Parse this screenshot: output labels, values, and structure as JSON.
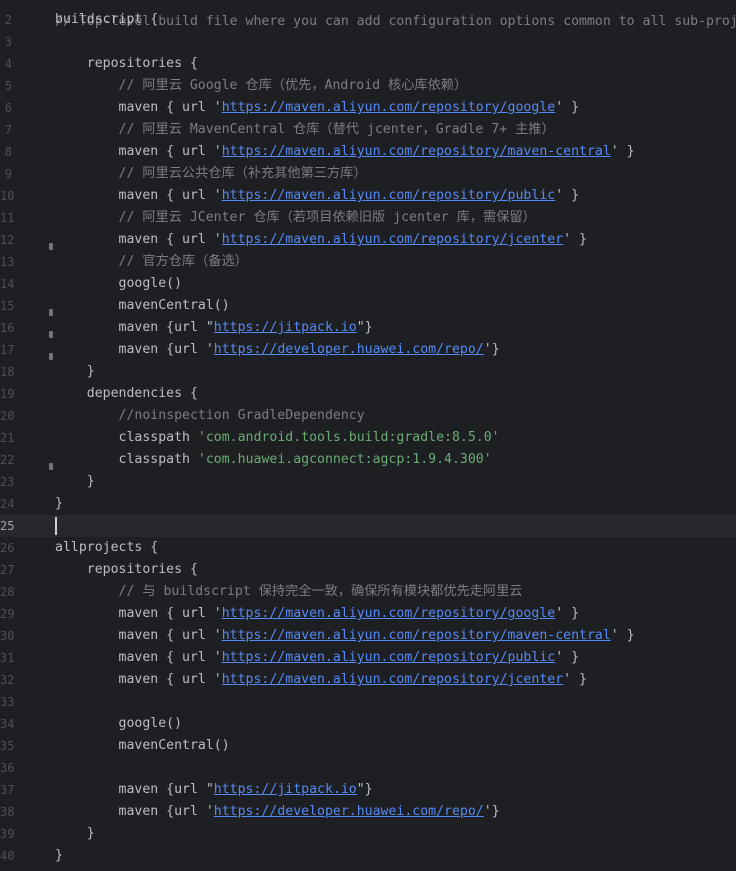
{
  "editor": {
    "top_comment": "// Top-level build file where you can add configuration options common to all sub-projects/modules.",
    "lines": [
      {
        "n": "2",
        "segs": [
          {
            "t": "buildscript {",
            "c": "kw"
          }
        ]
      },
      {
        "n": "3",
        "segs": []
      },
      {
        "n": "4",
        "segs": [
          {
            "t": "    repositories {",
            "c": "kw"
          }
        ]
      },
      {
        "n": "5",
        "segs": [
          {
            "t": "        // 阿里云 Google 仓库（优先，Android 核心库依赖）",
            "c": "cm"
          }
        ]
      },
      {
        "n": "6",
        "segs": [
          {
            "t": "        maven { url '",
            "c": "kw"
          },
          {
            "t": "https://maven.aliyun.com/repository/google",
            "c": "url"
          },
          {
            "t": "' }",
            "c": "kw"
          }
        ]
      },
      {
        "n": "7",
        "segs": [
          {
            "t": "        // 阿里云 MavenCentral 仓库（替代 jcenter，Gradle 7+ 主推）",
            "c": "cm"
          }
        ]
      },
      {
        "n": "8",
        "segs": [
          {
            "t": "        maven { url '",
            "c": "kw"
          },
          {
            "t": "https://maven.aliyun.com/repository/maven-central",
            "c": "url"
          },
          {
            "t": "' }",
            "c": "kw"
          }
        ]
      },
      {
        "n": "9",
        "segs": [
          {
            "t": "        // 阿里云公共仓库（补充其他第三方库）",
            "c": "cm"
          }
        ]
      },
      {
        "n": "10",
        "segs": [
          {
            "t": "        maven { url '",
            "c": "kw"
          },
          {
            "t": "https://maven.aliyun.com/repository/public",
            "c": "url"
          },
          {
            "t": "' }",
            "c": "kw"
          }
        ]
      },
      {
        "n": "11",
        "segs": [
          {
            "t": "        // 阿里云 JCenter 仓库（若项目依赖旧版 jcenter 库，需保留）",
            "c": "cm"
          }
        ]
      },
      {
        "n": "12",
        "segs": [
          {
            "t": "        maven { url '",
            "c": "kw"
          },
          {
            "t": "https://maven.aliyun.com/repository/jcenter",
            "c": "url"
          },
          {
            "t": "' }",
            "c": "kw"
          }
        ]
      },
      {
        "n": "13",
        "segs": [
          {
            "t": "        // 官方仓库（备选）",
            "c": "cm"
          }
        ]
      },
      {
        "n": "14",
        "segs": [
          {
            "t": "        google()",
            "c": "kw"
          }
        ]
      },
      {
        "n": "15",
        "segs": [
          {
            "t": "        mavenCentral()",
            "c": "kw"
          }
        ]
      },
      {
        "n": "16",
        "segs": [
          {
            "t": "        maven {url \"",
            "c": "kw"
          },
          {
            "t": "https://jitpack.io",
            "c": "url"
          },
          {
            "t": "\"}",
            "c": "kw"
          }
        ]
      },
      {
        "n": "17",
        "segs": [
          {
            "t": "        maven {url '",
            "c": "kw"
          },
          {
            "t": "https://developer.huawei.com/repo/",
            "c": "url"
          },
          {
            "t": "'}",
            "c": "kw"
          }
        ]
      },
      {
        "n": "18",
        "segs": [
          {
            "t": "    }",
            "c": "kw"
          }
        ]
      },
      {
        "n": "19",
        "segs": [
          {
            "t": "    dependencies {",
            "c": "kw"
          }
        ]
      },
      {
        "n": "20",
        "segs": [
          {
            "t": "        //noinspection GradleDependency",
            "c": "cm"
          }
        ]
      },
      {
        "n": "21",
        "segs": [
          {
            "t": "        classpath ",
            "c": "kw"
          },
          {
            "t": "'com.android.tools.build:gradle:8.5.0'",
            "c": "str"
          }
        ]
      },
      {
        "n": "22",
        "segs": [
          {
            "t": "        classpath ",
            "c": "kw"
          },
          {
            "t": "'com.huawei.agconnect:agcp:1.9.4.300'",
            "c": "str"
          }
        ]
      },
      {
        "n": "23",
        "segs": [
          {
            "t": "    }",
            "c": "kw"
          }
        ]
      },
      {
        "n": "24",
        "segs": [
          {
            "t": "}",
            "c": "kw"
          }
        ]
      },
      {
        "n": "25",
        "segs": [],
        "current": true
      },
      {
        "n": "26",
        "segs": [
          {
            "t": "allprojects {",
            "c": "kw"
          }
        ]
      },
      {
        "n": "27",
        "segs": [
          {
            "t": "    repositories {",
            "c": "kw"
          }
        ]
      },
      {
        "n": "28",
        "segs": [
          {
            "t": "        // 与 buildscript 保持完全一致，确保所有模块都优先走阿里云",
            "c": "cm"
          }
        ]
      },
      {
        "n": "29",
        "segs": [
          {
            "t": "        maven { url '",
            "c": "kw"
          },
          {
            "t": "https://maven.aliyun.com/repository/google",
            "c": "url"
          },
          {
            "t": "' }",
            "c": "kw"
          }
        ]
      },
      {
        "n": "30",
        "segs": [
          {
            "t": "        maven { url '",
            "c": "kw"
          },
          {
            "t": "https://maven.aliyun.com/repository/maven-central",
            "c": "url"
          },
          {
            "t": "' }",
            "c": "kw"
          }
        ]
      },
      {
        "n": "31",
        "segs": [
          {
            "t": "        maven { url '",
            "c": "kw"
          },
          {
            "t": "https://maven.aliyun.com/repository/public",
            "c": "url"
          },
          {
            "t": "' }",
            "c": "kw"
          }
        ]
      },
      {
        "n": "32",
        "segs": [
          {
            "t": "        maven { url '",
            "c": "kw"
          },
          {
            "t": "https://maven.aliyun.com/repository/jcenter",
            "c": "url"
          },
          {
            "t": "' }",
            "c": "kw"
          }
        ]
      },
      {
        "n": "33",
        "segs": []
      },
      {
        "n": "34",
        "segs": [
          {
            "t": "        google()",
            "c": "kw"
          }
        ]
      },
      {
        "n": "35",
        "segs": [
          {
            "t": "        mavenCentral()",
            "c": "kw"
          }
        ]
      },
      {
        "n": "36",
        "segs": []
      },
      {
        "n": "37",
        "segs": [
          {
            "t": "        maven {url \"",
            "c": "kw"
          },
          {
            "t": "https://jitpack.io",
            "c": "url"
          },
          {
            "t": "\"}",
            "c": "kw"
          }
        ]
      },
      {
        "n": "38",
        "segs": [
          {
            "t": "        maven {url '",
            "c": "kw"
          },
          {
            "t": "https://developer.huawei.com/repo/",
            "c": "url"
          },
          {
            "t": "'}",
            "c": "kw"
          }
        ]
      },
      {
        "n": "39",
        "segs": [
          {
            "t": "    }",
            "c": "kw"
          }
        ]
      },
      {
        "n": "40",
        "segs": [
          {
            "t": "}",
            "c": "kw"
          }
        ]
      }
    ],
    "fold_marker_lines": [
      "13",
      "16",
      "17",
      "18",
      "23"
    ]
  },
  "colors": {
    "background": "#1e1f22",
    "current_line": "#26282e",
    "code_text": "#bcbec4",
    "comment": "#7a7e85",
    "string": "#6aab73",
    "url": "#548af7",
    "line_number": "#4b5059"
  }
}
